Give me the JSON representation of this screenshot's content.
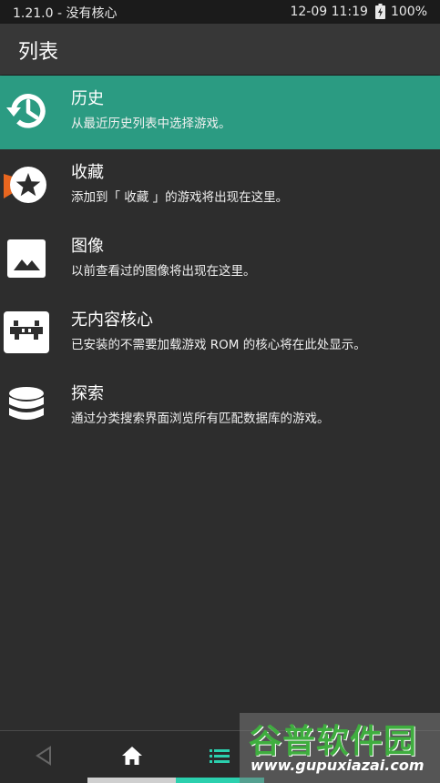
{
  "status_bar": {
    "left_text": "1.21.0 - 没有核心",
    "datetime": "12-09 11:19",
    "battery": "100%"
  },
  "header": {
    "title": "列表"
  },
  "menu": {
    "items": [
      {
        "label": "历史",
        "description": "从最近历史列表中选择游戏。",
        "icon": "history-icon",
        "selected": true
      },
      {
        "label": "收藏",
        "description": "添加到「 收藏 」的游戏将出现在这里。",
        "icon": "star-icon",
        "selected": false
      },
      {
        "label": "图像",
        "description": "以前查看过的图像将出现在这里。",
        "icon": "image-icon",
        "selected": false
      },
      {
        "label": "无内容核心",
        "description": "已安装的不需要加载游戏 ROM 的核心将在此处显示。",
        "icon": "retroarch-core-icon",
        "selected": false
      },
      {
        "label": "探索",
        "description": "通过分类搜索界面浏览所有匹配数据库的游戏。",
        "icon": "database-icon",
        "selected": false
      }
    ]
  },
  "bottom_nav": {
    "buttons": [
      {
        "icon": "back-triangle-icon"
      },
      {
        "icon": "home-icon"
      },
      {
        "icon": "list-icon",
        "active": true
      }
    ]
  },
  "watermark": {
    "title": "谷普软件园",
    "url": "www.gupuxiazai.com"
  },
  "colors": {
    "accent": "#2b9b82",
    "background": "#2d2d2d",
    "header": "#373737",
    "status_bar": "#1b1b1b"
  }
}
